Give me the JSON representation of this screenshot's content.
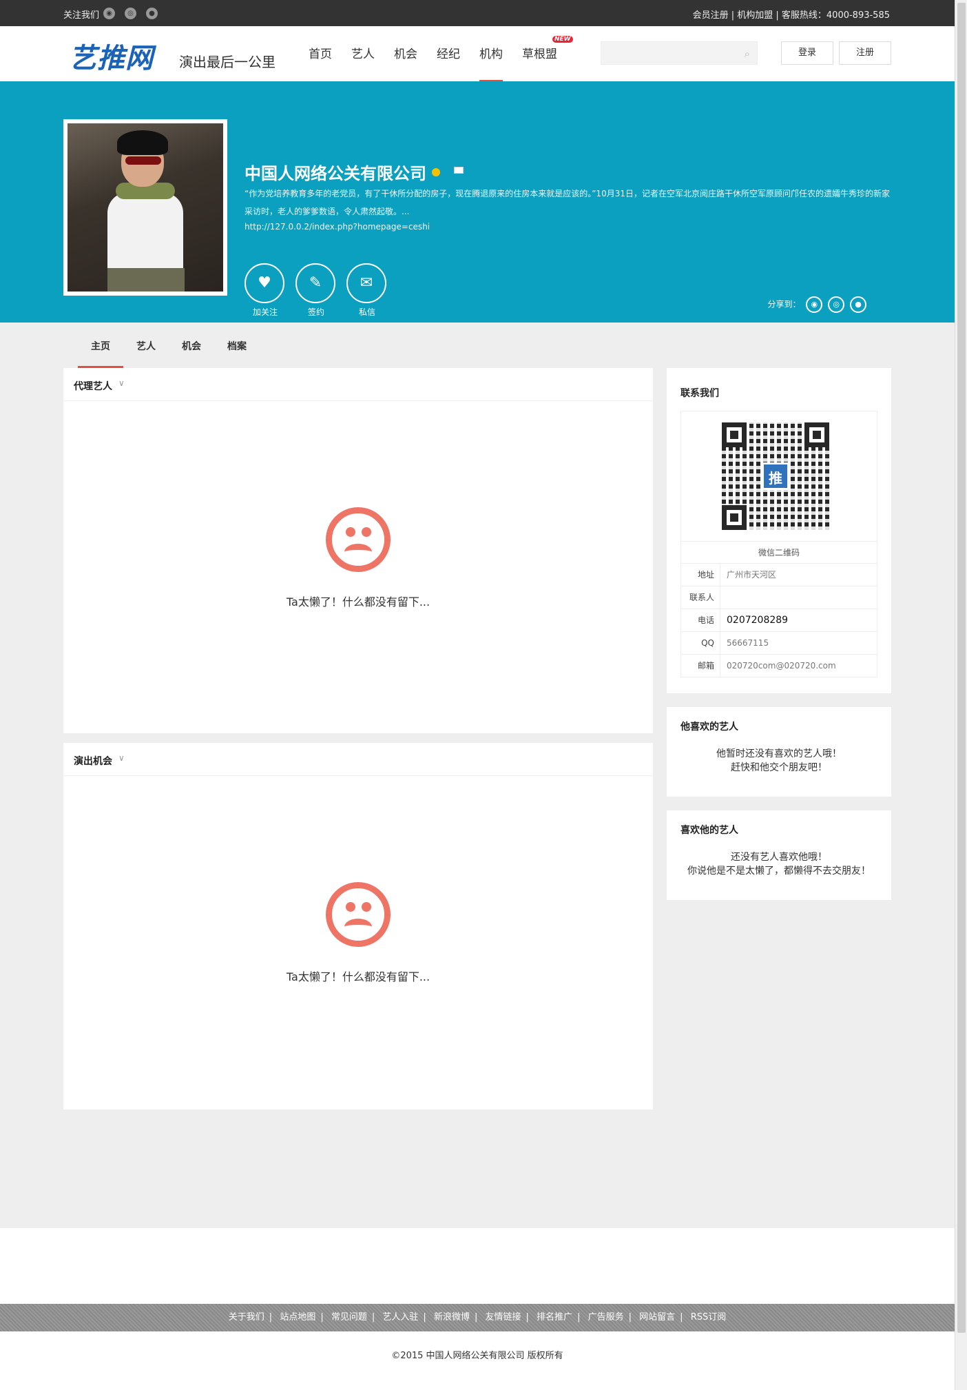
{
  "topbar": {
    "follow_label": "关注我们",
    "social_icons": [
      "weibo-icon",
      "tencent-icon",
      "wechat-icon"
    ],
    "right_links": "会员注册 | 机构加盟 | 客服热线：4000-893-585"
  },
  "header": {
    "logo": "艺推网",
    "slogan": "演出最后一公里",
    "nav": [
      {
        "label": "首页"
      },
      {
        "label": "艺人"
      },
      {
        "label": "机会"
      },
      {
        "label": "经纪"
      },
      {
        "label": "机构",
        "active": true
      },
      {
        "label": "草根盟",
        "badge": "NEW"
      }
    ],
    "search_placeholder": "",
    "login_label": "登录",
    "register_label": "注册"
  },
  "profile": {
    "name": "中国人网络公关有限公司",
    "description": "“作为党培养教育多年的老党员，有了干休所分配的房子，现在腾退原来的住房本来就是应该的。”10月31日，记者在空军北京阅庄路干休所空军原顾问邝任农的遗孀牛秀珍的新家采访时，老人的爹爹数语，令人肃然起敬。...",
    "homepage_url": "http://127.0.0.2/index.php?homepage=ceshi",
    "actions": [
      {
        "label": "加关注",
        "icon": "follow-heart-icon"
      },
      {
        "label": "签约",
        "icon": "pen-icon"
      },
      {
        "label": "私信",
        "icon": "mail-icon"
      }
    ],
    "share_label": "分享到："
  },
  "tabs": [
    "主页",
    "艺人",
    "机会",
    "档案"
  ],
  "panels": {
    "artists_title": "代理艺人",
    "opportunities_title": "演出机会",
    "empty_text": "Ta太懒了！什么都没有留下..."
  },
  "sidebar": {
    "contact_title": "联系我们",
    "qr_label": "微信二维码",
    "qr_center": "推",
    "rows": [
      {
        "key": "地址",
        "value": "广州市天河区"
      },
      {
        "key": "联系人",
        "value": ""
      },
      {
        "key": "电话",
        "value": "0207208289"
      },
      {
        "key": "QQ",
        "value": "56667115"
      },
      {
        "key": "邮箱",
        "value": "020720com@020720.com"
      }
    ],
    "likes_title": "他喜欢的艺人",
    "likes_msg1": "他暂时还没有喜欢的艺人哦！",
    "likes_msg2": "赶快和他交个朋友吧！",
    "liked_by_title": "喜欢他的艺人",
    "liked_by_msg1": "还没有艺人喜欢他哦！",
    "liked_by_msg2": "你说他是不是太懒了，都懒得不去交朋友！"
  },
  "footer": {
    "links": [
      "关于我们",
      "站点地图",
      "常见问题",
      "艺人入驻",
      "新浪微博",
      "友情链接",
      "排名推广",
      "广告服务",
      "网站留言",
      "RSS订阅"
    ],
    "copyright": "©2015 中国人网络公关有限公司 版权所有"
  },
  "colors": {
    "banner": "#0ba0c0",
    "accent": "#e74c3c",
    "sad_face": "#ee7466",
    "logo": "#1a63b8"
  }
}
